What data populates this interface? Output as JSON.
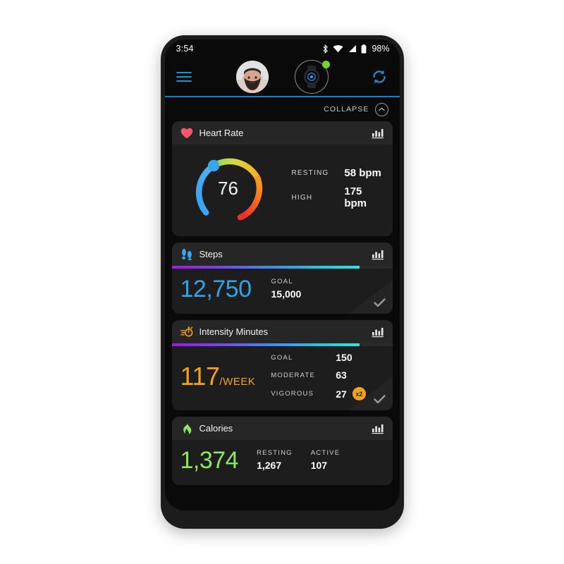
{
  "colors": {
    "accent_blue": "#1e8fd5",
    "heart_pink": "#f4576e",
    "steps_blue": "#33a3e8",
    "intensity_orange": "#f5a316",
    "calories_green": "#8ce85c",
    "status_dot_green": "#78d423",
    "card_bg": "#1d1d1d",
    "card_head_bg": "#262626",
    "screen_bg": "#0a0a0a"
  },
  "statusbar": {
    "time": "3:54",
    "battery_percent": "98%",
    "icons": [
      "bluetooth-icon",
      "wifi-icon",
      "cellular-signal-icon",
      "battery-icon"
    ]
  },
  "appbar": {
    "menu_icon": "hamburger-menu-icon",
    "avatar_label": "user-avatar",
    "device_label": "paired-watch",
    "device_connected": true,
    "sync_icon": "sync-refresh-icon"
  },
  "collapse": {
    "label": "COLLAPSE",
    "icon": "chevron-up-icon"
  },
  "cards": {
    "heart_rate": {
      "title": "Heart Rate",
      "icon": "heart-icon",
      "chart_icon": "bar-chart-icon",
      "current_bpm": "76",
      "stats": [
        {
          "label": "RESTING",
          "value": "58 bpm"
        },
        {
          "label": "HIGH",
          "value": "175 bpm"
        }
      ]
    },
    "steps": {
      "title": "Steps",
      "icon": "footprints-icon",
      "chart_icon": "bar-chart-icon",
      "value": "12,750",
      "goal_label": "GOAL",
      "goal_value": "15,000",
      "progress_percent": 85,
      "goal_met_icon": "checkmark-icon"
    },
    "intensity_minutes": {
      "title": "Intensity Minutes",
      "icon": "stopwatch-icon",
      "chart_icon": "bar-chart-icon",
      "value": "117",
      "unit": "/WEEK",
      "progress_percent": 85,
      "stats": [
        {
          "label": "GOAL",
          "value": "150",
          "badge": ""
        },
        {
          "label": "MODERATE",
          "value": "63",
          "badge": ""
        },
        {
          "label": "VIGOROUS",
          "value": "27",
          "badge": "x2"
        }
      ],
      "goal_met_icon": "checkmark-icon"
    },
    "calories": {
      "title": "Calories",
      "icon": "flame-icon",
      "chart_icon": "bar-chart-icon",
      "value": "1,374",
      "stats": [
        {
          "label": "RESTING",
          "value": "1,267"
        },
        {
          "label": "ACTIVE",
          "value": "107"
        }
      ]
    }
  }
}
